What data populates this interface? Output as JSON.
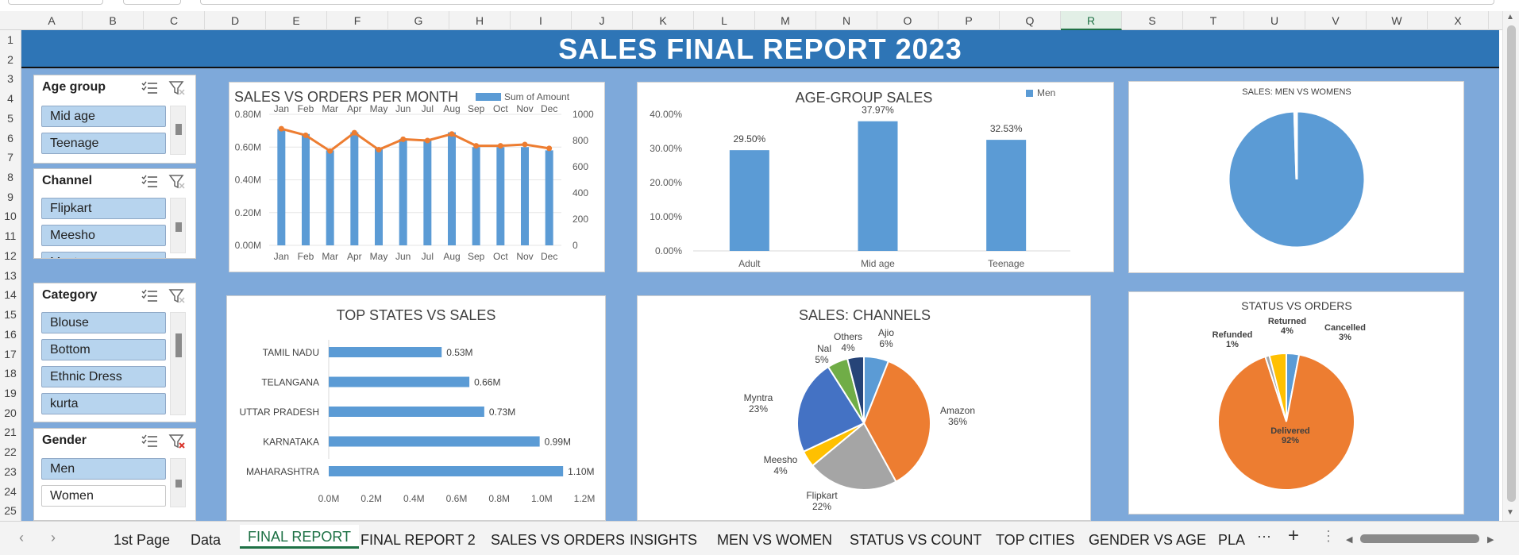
{
  "sheet": {
    "columns": [
      "A",
      "B",
      "C",
      "D",
      "E",
      "F",
      "G",
      "H",
      "I",
      "J",
      "K",
      "L",
      "M",
      "N",
      "O",
      "P",
      "Q",
      "R",
      "S",
      "T",
      "U",
      "V",
      "W",
      "X"
    ],
    "active_column": "R",
    "rows": [
      "1",
      "2",
      "3",
      "4",
      "5",
      "6",
      "7",
      "8",
      "9",
      "10",
      "11",
      "12",
      "13",
      "14",
      "15",
      "16",
      "17",
      "18",
      "19",
      "20",
      "21",
      "22",
      "23",
      "24",
      "25"
    ]
  },
  "report": {
    "title": "SALES FINAL REPORT 2023"
  },
  "slicers": {
    "age_group": {
      "title": "Age group",
      "items": [
        "Mid age",
        "Teenage"
      ]
    },
    "channel": {
      "title": "Channel",
      "items": [
        "Flipkart",
        "Meesho",
        "Myntra"
      ]
    },
    "category": {
      "title": "Category",
      "items": [
        "Blouse",
        "Bottom",
        "Ethnic Dress",
        "kurta"
      ]
    },
    "gender": {
      "title": "Gender",
      "items": [
        "Men",
        "Women"
      ]
    }
  },
  "chart_data": [
    {
      "id": "sales_vs_orders",
      "type": "bar",
      "title": "SALES VS ORDERS PER MONTH",
      "categories": [
        "Jan",
        "Feb",
        "Mar",
        "Apr",
        "May",
        "Jun",
        "Jul",
        "Aug",
        "Sep",
        "Oct",
        "Nov",
        "Dec"
      ],
      "series": [
        {
          "name": "Sum of Amount",
          "type": "bar",
          "values": [
            0.71,
            0.68,
            0.58,
            0.69,
            0.59,
            0.65,
            0.64,
            0.69,
            0.6,
            0.6,
            0.6,
            0.58
          ]
        },
        {
          "type": "line",
          "axis": "right",
          "values": [
            890,
            840,
            720,
            860,
            730,
            810,
            800,
            850,
            760,
            760,
            770,
            740
          ]
        }
      ],
      "y_ticks": [
        "0.00M",
        "0.20M",
        "0.40M",
        "0.60M",
        "0.80M"
      ],
      "y2_ticks": [
        "0",
        "200",
        "400",
        "600",
        "800",
        "1000"
      ],
      "ylim": [
        0,
        0.8
      ],
      "y2lim": [
        0,
        1000
      ],
      "colors": {
        "bar": "#5b9bd5",
        "line": "#ed7d31"
      }
    },
    {
      "id": "age_group_sales",
      "type": "bar",
      "title": "AGE-GROUP SALES",
      "categories": [
        "Adult",
        "Mid age",
        "Teenage"
      ],
      "series": [
        {
          "name": "Men",
          "values": [
            29.5,
            37.97,
            32.53
          ]
        }
      ],
      "data_labels": [
        "29.50%",
        "37.97%",
        "32.53%"
      ],
      "y_ticks": [
        "0.00%",
        "10.00%",
        "20.00%",
        "30.00%",
        "40.00%"
      ],
      "ylim": [
        0,
        40
      ],
      "colors": {
        "bar": "#5b9bd5"
      }
    },
    {
      "id": "men_vs_women",
      "type": "pie",
      "title": "SALES: MEN VS WOMENS",
      "values": [
        99.5,
        0.5
      ],
      "colors": [
        "#5b9bd5",
        "#ffffff"
      ]
    },
    {
      "id": "top_states",
      "type": "bar",
      "orientation": "horizontal",
      "title": "TOP STATES VS SALES",
      "categories": [
        "TAMIL NADU",
        "TELANGANA",
        "UTTAR PRADESH",
        "KARNATAKA",
        "MAHARASHTRA"
      ],
      "values": [
        0.53,
        0.66,
        0.73,
        0.99,
        1.1
      ],
      "data_labels": [
        "0.53M",
        "0.66M",
        "0.73M",
        "0.99M",
        "1.10M"
      ],
      "x_ticks": [
        "0.0M",
        "0.2M",
        "0.4M",
        "0.6M",
        "0.8M",
        "1.0M",
        "1.2M"
      ],
      "xlim": [
        0,
        1.2
      ],
      "colors": {
        "bar": "#5b9bd5"
      }
    },
    {
      "id": "sales_channels",
      "type": "pie",
      "title": "SALES: CHANNELS",
      "labels": [
        "Ajio",
        "Amazon",
        "Flipkart",
        "Meesho",
        "Myntra",
        "Nalli",
        "Others"
      ],
      "display_labels": [
        "Ajio",
        "Amazon",
        "Flipkart",
        "Meesho",
        "Myntra",
        "Nal",
        "Others"
      ],
      "values": [
        6,
        36,
        22,
        4,
        23,
        5,
        4
      ],
      "percent_labels": [
        "6%",
        "36%",
        "22%",
        "4%",
        "23%",
        "5%",
        "4%"
      ],
      "colors": [
        "#5b9bd5",
        "#ed7d31",
        "#a5a5a5",
        "#ffc000",
        "#4472c4",
        "#70ad47",
        "#264478"
      ]
    },
    {
      "id": "status_vs_orders",
      "type": "pie",
      "title": "STATUS VS ORDERS",
      "labels": [
        "Cancelled",
        "Delivered",
        "Refunded",
        "Returned"
      ],
      "values": [
        3,
        92,
        1,
        4
      ],
      "percent_labels": [
        "3%",
        "92%",
        "1%",
        "4%"
      ],
      "colors": [
        "#5b9bd5",
        "#ed7d31",
        "#a5a5a5",
        "#ffc000"
      ]
    }
  ],
  "tabs": [
    {
      "label": "1st Page",
      "active": false
    },
    {
      "label": "Data",
      "active": false
    },
    {
      "label": "FINAL REPORT",
      "active": true
    },
    {
      "label": "FINAL REPORT 2",
      "active": false
    },
    {
      "label": "SALES VS ORDERS",
      "active": false
    },
    {
      "label": "INSIGHTS",
      "active": false
    },
    {
      "label": "MEN VS WOMEN",
      "active": false
    },
    {
      "label": "STATUS VS COUNT",
      "active": false
    },
    {
      "label": "TOP CITIES",
      "active": false
    },
    {
      "label": "GENDER VS AGE",
      "active": false
    },
    {
      "label": "PLA",
      "active": false
    }
  ],
  "bottom_controls": {
    "more": "···",
    "add": "+",
    "menu": "⋮"
  }
}
